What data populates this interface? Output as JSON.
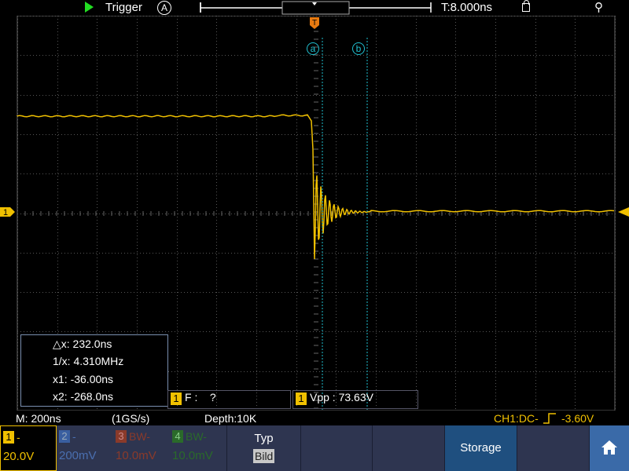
{
  "topbar": {
    "trigger_label": "Trigger",
    "trigger_mode_icon": "A",
    "timebase_position": "T:8.000ns",
    "lock_icon": "lock-icon",
    "usb_icon": "usb-icon"
  },
  "markers": {
    "trigger_marker": "T",
    "cursor_a": "a",
    "cursor_b": "b",
    "channel1_marker": "1"
  },
  "cursor_panel": {
    "dx": "△x: 232.0ns",
    "inv_dx": "1/x: 4.310MHz",
    "x1": "x1: -36.00ns",
    "x2": "x2: -268.0ns"
  },
  "measurements": {
    "freq_channel": "1",
    "freq_text": "F :    ?",
    "vpp_channel": "1",
    "vpp_text": "Vpp : 73.63V"
  },
  "status": {
    "timebase": "M: 200ns",
    "sample_rate": "(1GS/s)",
    "depth": "Depth:10K",
    "trigger_info": "CH1:DC-",
    "trigger_level": "-3.60V"
  },
  "menu": {
    "channels": [
      {
        "num": "1",
        "name": "-",
        "value": "20.0V",
        "color": "#f0c000",
        "active": true
      },
      {
        "num": "2",
        "name": "-",
        "value": "200mV",
        "color": "#3a5fa0",
        "active": false
      },
      {
        "num": "3",
        "name": "BW-",
        "value": "10.0mV",
        "color": "#8a3a2a",
        "active": false
      },
      {
        "num": "4",
        "name": "BW-",
        "value": "10.0mV",
        "color": "#2a6a2a",
        "active": false
      }
    ],
    "typ_label": "Typ",
    "typ_value": "Bild",
    "storage_label": "Storage",
    "home_icon": "home-icon"
  },
  "colors": {
    "trace": "#f0c000",
    "cursor": "#20c0d0",
    "menu_bg": "#2e3550",
    "storage_bg": "#1f4f7f",
    "home_bg": "#3a6aa8"
  }
}
